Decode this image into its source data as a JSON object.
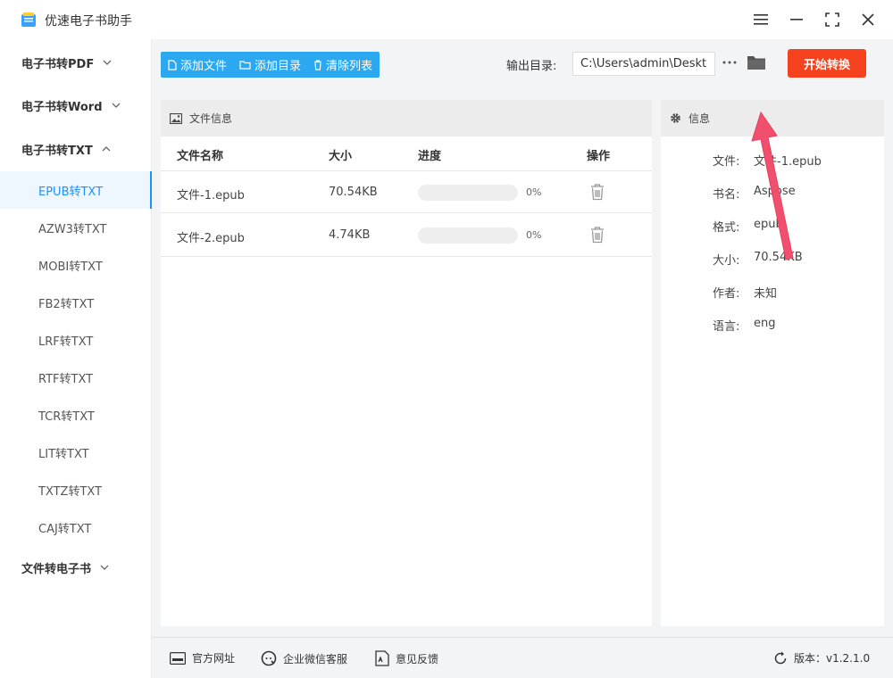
{
  "app": {
    "title": "优速电子书助手"
  },
  "sidebar": {
    "categories": [
      {
        "label": "电子书转PDF",
        "expanded": false
      },
      {
        "label": "电子书转Word",
        "expanded": false
      },
      {
        "label": "电子书转TXT",
        "expanded": true
      },
      {
        "label": "文件转电子书",
        "expanded": false
      }
    ],
    "txt_items": [
      "EPUB转TXT",
      "AZW3转TXT",
      "MOBI转TXT",
      "FB2转TXT",
      "LRF转TXT",
      "RTF转TXT",
      "TCR转TXT",
      "LIT转TXT",
      "TXTZ转TXT",
      "CAJ转TXT"
    ],
    "active_item": "EPUB转TXT"
  },
  "toolbar": {
    "add_file": "添加文件",
    "add_dir": "添加目录",
    "clear_list": "清除列表",
    "output_label": "输出目录:",
    "output_path": "C:\\Users\\admin\\Desktop",
    "start_button": "开始转换"
  },
  "file_panel": {
    "title": "文件信息",
    "columns": {
      "name": "文件名称",
      "size": "大小",
      "progress": "进度",
      "action": "操作"
    },
    "rows": [
      {
        "name": "文件-1.epub",
        "size": "70.54KB",
        "progress": 0,
        "progress_text": "0%"
      },
      {
        "name": "文件-2.epub",
        "size": "4.74KB",
        "progress": 0,
        "progress_text": "0%"
      }
    ]
  },
  "info_panel": {
    "title": "信息",
    "fields": [
      {
        "key": "文件:",
        "value": "文件-1.epub"
      },
      {
        "key": "书名:",
        "value": "Aspose"
      },
      {
        "key": "格式:",
        "value": "epub"
      },
      {
        "key": "大小:",
        "value": "70.54KB"
      },
      {
        "key": "作者:",
        "value": "未知"
      },
      {
        "key": "语言:",
        "value": "eng"
      }
    ]
  },
  "footer": {
    "website": "官方网址",
    "wechat": "企业微信客服",
    "feedback": "意见反馈",
    "version": "版本：v1.2.1.0"
  },
  "colors": {
    "accent": "#2ba8f0",
    "start": "#f5411e",
    "arrow": "#f0506e"
  }
}
